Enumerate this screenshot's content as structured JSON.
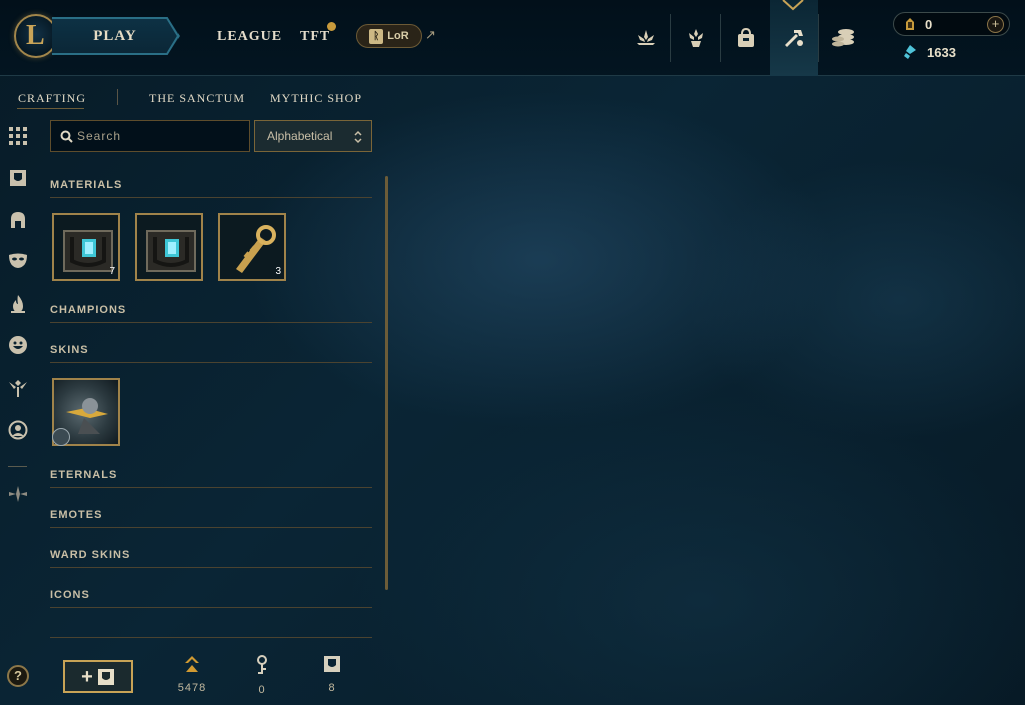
{
  "header": {
    "play_label": "PLAY",
    "nav": [
      {
        "label": "LEAGUE"
      },
      {
        "label": "TFT"
      }
    ],
    "lor_label": "LoR",
    "lor_external_icon": "external-link-icon",
    "store_icons": [
      "profile-flower-icon",
      "challenges-icon",
      "inventory-bag-icon",
      "loot-crafting-icon",
      "store-coins-icon"
    ],
    "currency": {
      "orange_essence": "0",
      "blue_essence": "1633"
    }
  },
  "subnav": {
    "items": [
      "CRAFTING",
      "THE SANCTUM",
      "MYTHIC SHOP"
    ],
    "active": "CRAFTING"
  },
  "rail": {
    "icons": [
      "all-items-grid-icon",
      "chest-icon",
      "champion-helmet-icon",
      "skin-mask-icon",
      "eternals-flame-icon",
      "emote-face-icon",
      "ward-icon",
      "profile-icon-circle-icon",
      "collapse-arrows-icon"
    ],
    "help_label": "?"
  },
  "filters": {
    "search_placeholder": "Search",
    "sort_value": "Alphabetical"
  },
  "sections": {
    "materials": "MATERIALS",
    "champions": "CHAMPIONS",
    "skins": "SKINS",
    "eternals": "ETERNALS",
    "emotes": "EMOTES",
    "ward_skins": "WARD SKINS",
    "icons": "ICONS"
  },
  "materials": [
    {
      "name": "hextech-chest",
      "count": "7"
    },
    {
      "name": "hextech-chest-2",
      "count": ""
    },
    {
      "name": "key-fragment",
      "count": "3"
    }
  ],
  "footer": {
    "essence": "5478",
    "keys": "0",
    "chests": "8"
  },
  "colors": {
    "gold": "#c89b3c",
    "gold_border": "#a0834a",
    "teal": "#2a6f86",
    "blue_essence": "#4fc3d8"
  }
}
